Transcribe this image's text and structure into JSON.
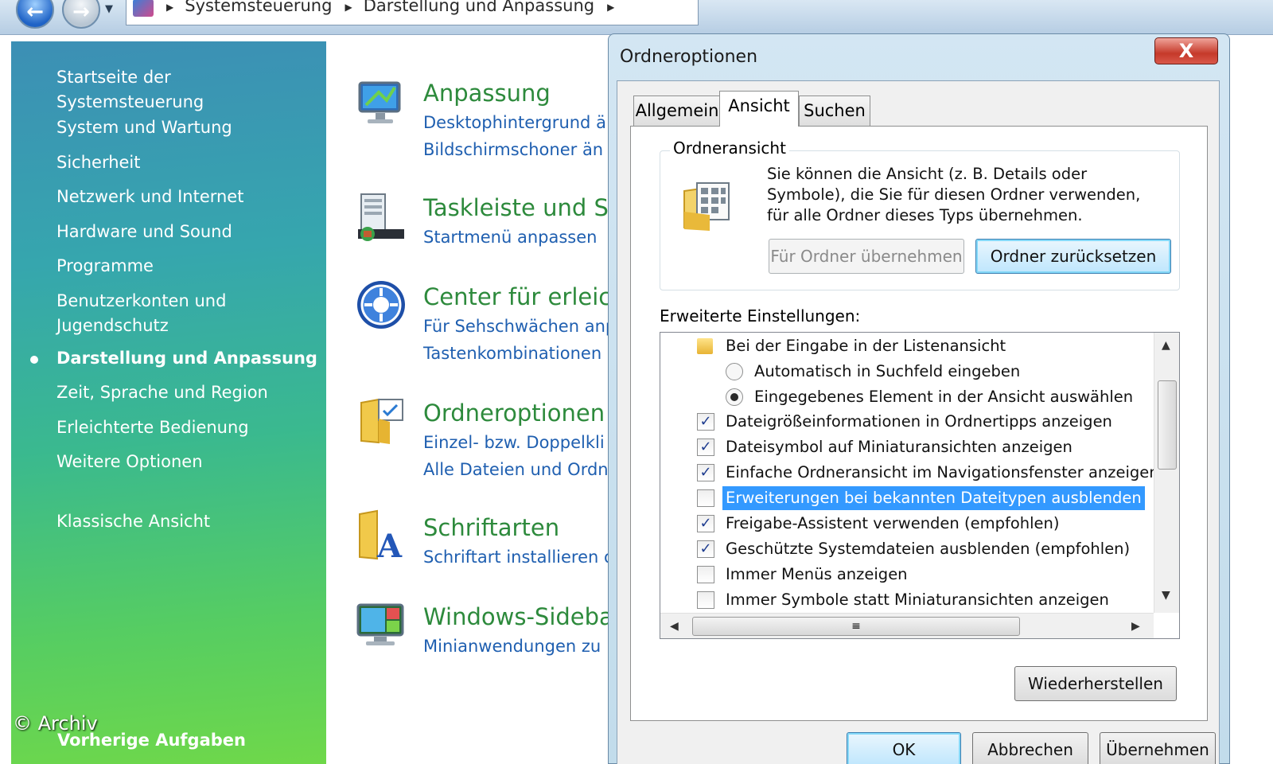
{
  "address_bar": {
    "breadcrumbs": [
      "Systemsteuerung",
      "Darstellung und Anpassung"
    ]
  },
  "nav_pane": {
    "home": "Startseite der Systemsteuerung",
    "items": [
      "System und Wartung",
      "Sicherheit",
      "Netzwerk und Internet",
      "Hardware und Sound",
      "Programme",
      "Benutzerkonten und Jugendschutz",
      "Darstellung und Anpassung",
      "Zeit, Sprache und Region",
      "Erleichterte Bedienung",
      "Weitere Optionen"
    ],
    "active_item": "Darstellung und Anpassung",
    "classic_view": "Klassische Ansicht",
    "previous_tasks": "Vorherige Aufgaben"
  },
  "watermark": "© Archiv",
  "categories": [
    {
      "title": "Anpassung",
      "links": [
        "Desktophintergrund ä",
        "Bildschirmschoner än"
      ],
      "icon": "display-settings-icon"
    },
    {
      "title": "Taskleiste und St",
      "links": [
        "Startmenü anpassen"
      ],
      "icon": "taskbar-icon"
    },
    {
      "title": "Center für erleich",
      "links": [
        "Für Sehschwächen anp",
        "Tastenkombinationen"
      ],
      "icon": "ease-of-access-icon"
    },
    {
      "title": "Ordneroptionen",
      "links": [
        "Einzel- bzw. Doppelkli",
        "Alle Dateien und Ordn"
      ],
      "icon": "folder-options-icon"
    },
    {
      "title": "Schriftarten",
      "links": [
        "Schriftart installieren o"
      ],
      "icon": "fonts-icon"
    },
    {
      "title": "Windows-Sideba",
      "links": [
        "Minianwendungen zu"
      ],
      "icon": "sidebar-icon"
    }
  ],
  "dialog": {
    "title": "Ordneroptionen",
    "close_label": "X",
    "tabs": [
      "Allgemein",
      "Ansicht",
      "Suchen"
    ],
    "active_tab": "Ansicht",
    "group": {
      "label": "Ordneransicht",
      "text": "Sie können die Ansicht (z. B. Details oder Symbole), die Sie für diesen Ordner verwenden, für alle Ordner dieses Typs übernehmen.",
      "apply_button": "Für Ordner übernehmen",
      "reset_button": "Ordner zurücksetzen"
    },
    "advanced_label": "Erweiterte Einstellungen:",
    "settings": [
      {
        "type": "folder",
        "label": "Bei der Eingabe in der Listenansicht"
      },
      {
        "type": "radio",
        "checked": false,
        "label": "Automatisch in Suchfeld eingeben"
      },
      {
        "type": "radio",
        "checked": true,
        "label": "Eingegebenes Element in der Ansicht auswählen"
      },
      {
        "type": "checkbox",
        "checked": true,
        "label": "Dateigrößeinformationen in Ordnertipps anzeigen"
      },
      {
        "type": "checkbox",
        "checked": true,
        "label": "Dateisymbol auf Miniaturansichten anzeigen"
      },
      {
        "type": "checkbox",
        "checked": true,
        "label": "Einfache Ordneransicht im Navigationsfenster anzeigen"
      },
      {
        "type": "checkbox",
        "checked": false,
        "selected": true,
        "label": "Erweiterungen bei bekannten Dateitypen ausblenden"
      },
      {
        "type": "checkbox",
        "checked": true,
        "label": "Freigabe-Assistent verwenden (empfohlen)"
      },
      {
        "type": "checkbox",
        "checked": true,
        "label": "Geschützte Systemdateien ausblenden (empfohlen)"
      },
      {
        "type": "checkbox",
        "checked": false,
        "label": "Immer Menüs anzeigen"
      },
      {
        "type": "checkbox",
        "checked": false,
        "label": "Immer Symbole statt Miniaturansichten anzeigen"
      }
    ],
    "restore_button": "Wiederherstellen",
    "ok_button": "OK",
    "cancel_button": "Abbrechen",
    "apply_button": "Übernehmen"
  }
}
